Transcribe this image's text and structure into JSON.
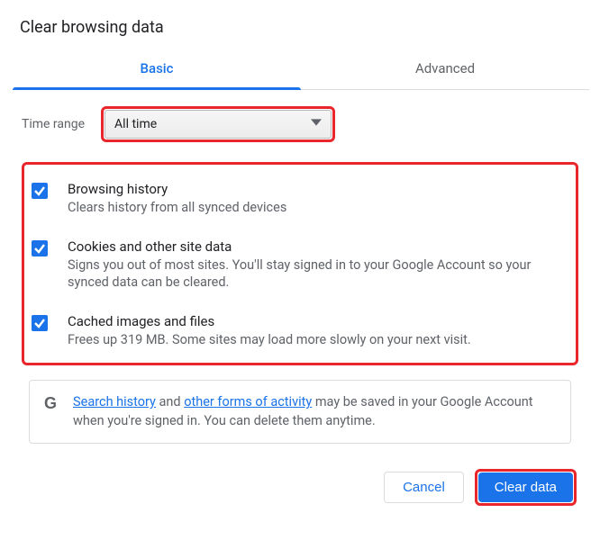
{
  "dialog": {
    "title": "Clear browsing data"
  },
  "tabs": {
    "basic": "Basic",
    "advanced": "Advanced"
  },
  "time": {
    "label": "Time range",
    "value": "All time"
  },
  "options": [
    {
      "title": "Browsing history",
      "desc": "Clears history from all synced devices"
    },
    {
      "title": "Cookies and other site data",
      "desc": "Signs you out of most sites. You'll stay signed in to your Google Account so your synced data can be cleared."
    },
    {
      "title": "Cached images and files",
      "desc": "Frees up 319 MB. Some sites may load more slowly on your next visit."
    }
  ],
  "info": {
    "link1": "Search history",
    "mid1": " and ",
    "link2": "other forms of activity",
    "rest": " may be saved in your Google Account when you're signed in. You can delete them anytime."
  },
  "footer": {
    "cancel": "Cancel",
    "clear": "Clear data"
  }
}
